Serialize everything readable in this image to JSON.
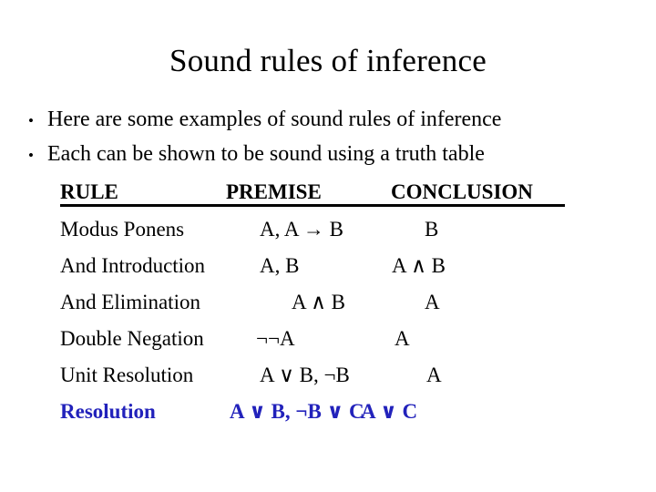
{
  "slide": {
    "title": "Sound rules of inference",
    "bullets": [
      {
        "marker": "•",
        "text": "Here are some examples of sound rules of inference"
      },
      {
        "marker": "•",
        "text": "Each can be shown to be sound using a truth table"
      }
    ],
    "table": {
      "headers": {
        "rule": "RULE",
        "premise": "PREMISE",
        "conclusion": "CONCLUSION"
      },
      "rows": [
        {
          "rule": "Modus Ponens",
          "premise": "A, A → B",
          "conclusion": "B",
          "color": "#000000"
        },
        {
          "rule": "And Introduction",
          "premise": "A, B",
          "conclusion": "A ∧ B",
          "color": "#000000"
        },
        {
          "rule": "And Elimination",
          "premise": "A ∧ B",
          "conclusion": "A",
          "color": "#000000"
        },
        {
          "rule": "Double Negation",
          "premise": "¬¬A",
          "conclusion": "A",
          "color": "#000000"
        },
        {
          "rule": "Unit Resolution",
          "premise": "A ∨ B, ¬B",
          "conclusion": "A",
          "color": "#000000"
        },
        {
          "rule": "Resolution",
          "premise": "A ∨ B, ¬B ∨ C",
          "conclusion": "A ∨ C",
          "color": "#2222BB"
        }
      ]
    },
    "colors": {
      "background": "#FFFFFF",
      "text": "#000000",
      "highlight": "#2222BB"
    }
  }
}
